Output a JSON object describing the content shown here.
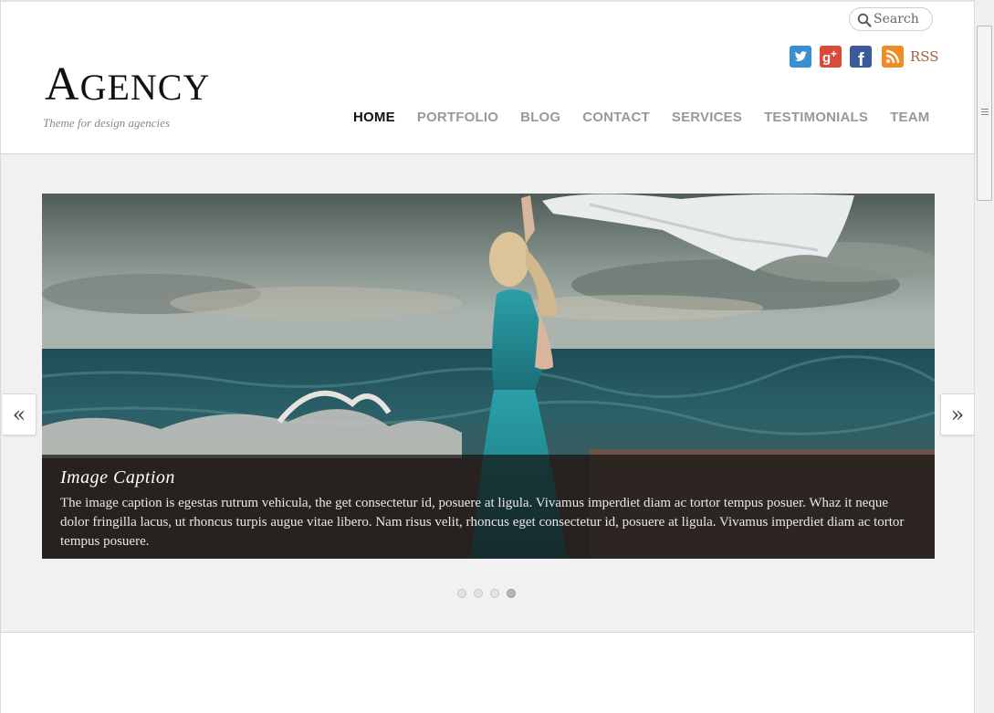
{
  "header": {
    "logo_initial": "A",
    "logo_rest": "GENCY",
    "tagline": "Theme for design agencies",
    "search_placeholder": "Search",
    "social": [
      {
        "name": "twitter",
        "color": "#3a8fd0"
      },
      {
        "name": "google-plus",
        "color": "#d94a38"
      },
      {
        "name": "facebook",
        "color": "#3b5a99"
      },
      {
        "name": "rss",
        "color": "#f18b26"
      }
    ],
    "rss_label": "RSS"
  },
  "nav": {
    "items": [
      "HOME",
      "PORTFOLIO",
      "BLOG",
      "CONTACT",
      "SERVICES",
      "TESTIMONIALS",
      "TEAM"
    ],
    "active": "HOME"
  },
  "slider": {
    "caption_title": "Image Caption",
    "caption_text": "The image caption is egestas rutrum vehicula, the get consectetur id, posuere at ligula. Vivamus imperdiet diam ac tortor tempus posuer. Whaz it neque dolor fringilla lacus, ut rhoncus turpis augue vitae libero. Nam risus velit, rhoncus eget consectetur id, posuere at ligula. Vivamus imperdiet diam ac tortor tempus posuere.",
    "prev_label": "«",
    "next_label": "»",
    "slide_count": 4,
    "active_slide": 4
  }
}
